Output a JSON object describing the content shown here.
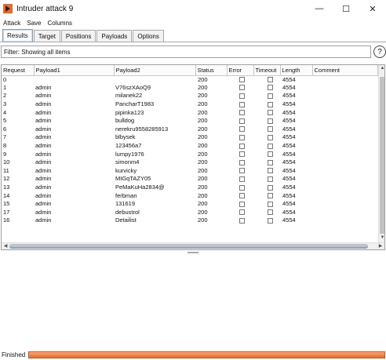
{
  "window": {
    "title": "Intruder attack 9",
    "minimize": "—",
    "maximize": "☐",
    "close": "✕"
  },
  "menu": [
    "Attack",
    "Save",
    "Columns"
  ],
  "tabs": [
    "Results",
    "Target",
    "Positions",
    "Payloads",
    "Options"
  ],
  "active_tab": "Results",
  "filter": {
    "text": "Filter: Showing all items",
    "help": "?"
  },
  "table": {
    "columns": [
      "Request",
      "Payload1",
      "Payload2",
      "Status",
      "Error",
      "Timeout",
      "Length",
      "Comment"
    ],
    "rows": [
      {
        "request": "0",
        "payload1": "",
        "payload2": "",
        "status": "200",
        "length": "4554",
        "comment": ""
      },
      {
        "request": "1",
        "payload1": "admin",
        "payload2": "V76szXAoQ9",
        "status": "200",
        "length": "4554",
        "comment": ""
      },
      {
        "request": "2",
        "payload1": "admin",
        "payload2": "milanek22",
        "status": "200",
        "length": "4554",
        "comment": ""
      },
      {
        "request": "3",
        "payload1": "admin",
        "payload2": "PancharT1983",
        "status": "200",
        "length": "4554",
        "comment": ""
      },
      {
        "request": "4",
        "payload1": "admin",
        "payload2": "pipinka123",
        "status": "200",
        "length": "4554",
        "comment": ""
      },
      {
        "request": "5",
        "payload1": "admin",
        "payload2": "bulldog",
        "status": "200",
        "length": "4554",
        "comment": ""
      },
      {
        "request": "6",
        "payload1": "admin",
        "payload2": "nerekru9558285913",
        "status": "200",
        "length": "4554",
        "comment": ""
      },
      {
        "request": "7",
        "payload1": "admin",
        "payload2": "blbysek",
        "status": "200",
        "length": "4554",
        "comment": ""
      },
      {
        "request": "8",
        "payload1": "admin",
        "payload2": "123456a7",
        "status": "200",
        "length": "4554",
        "comment": ""
      },
      {
        "request": "9",
        "payload1": "admin",
        "payload2": "lumpy1976",
        "status": "200",
        "length": "4554",
        "comment": ""
      },
      {
        "request": "10",
        "payload1": "admin",
        "payload2": "simonm4",
        "status": "200",
        "length": "4554",
        "comment": ""
      },
      {
        "request": "11",
        "payload1": "admin",
        "payload2": "kurvicky",
        "status": "200",
        "length": "4554",
        "comment": ""
      },
      {
        "request": "12",
        "payload1": "admin",
        "payload2": "MIGqTAZY05",
        "status": "200",
        "length": "4554",
        "comment": ""
      },
      {
        "request": "13",
        "payload1": "admin",
        "payload2": "PeMaKuHa2834@",
        "status": "200",
        "length": "4554",
        "comment": ""
      },
      {
        "request": "14",
        "payload1": "admin",
        "payload2": "ferbman",
        "status": "200",
        "length": "4554",
        "comment": ""
      },
      {
        "request": "15",
        "payload1": "admin",
        "payload2": "131619",
        "status": "200",
        "length": "4554",
        "comment": ""
      },
      {
        "request": "17",
        "payload1": "admin",
        "payload2": "debustrol",
        "status": "200",
        "length": "4554",
        "comment": ""
      },
      {
        "request": "16",
        "payload1": "admin",
        "payload2": "Detailist",
        "status": "200",
        "length": "4554",
        "comment": ""
      }
    ]
  },
  "status": {
    "label": "Finished",
    "progress": 1.0,
    "progress_color": "#e9692e"
  }
}
